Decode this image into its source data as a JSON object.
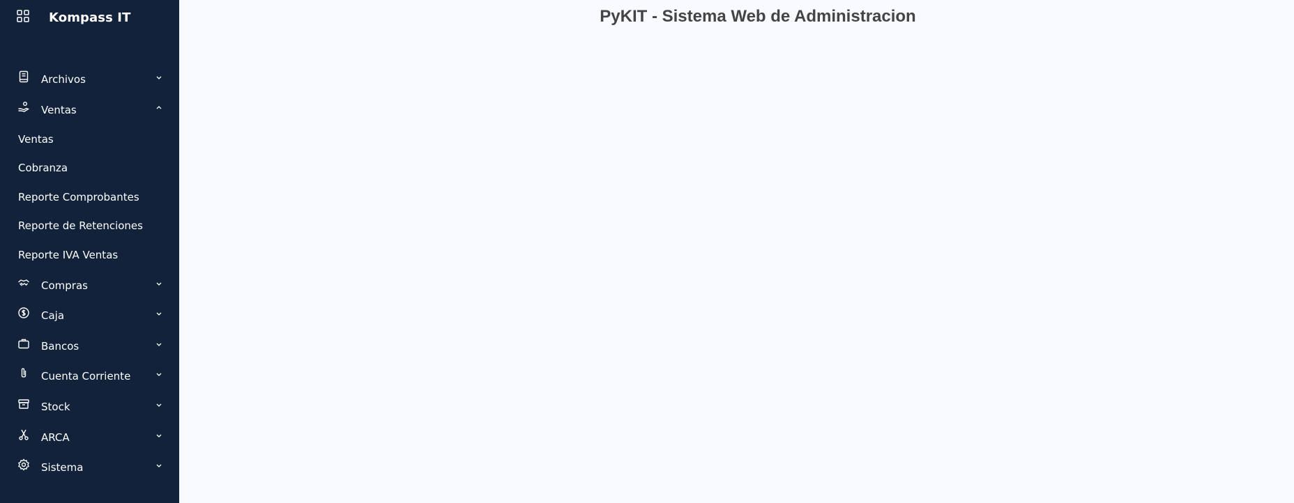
{
  "brand": {
    "title": "Kompass IT",
    "icon": "grid-icon"
  },
  "header": {
    "title": "PyKIT - Sistema Web de Administracion"
  },
  "sidebar": {
    "items": [
      {
        "label": "Archivos",
        "icon": "book-icon",
        "expanded": false
      },
      {
        "label": "Ventas",
        "icon": "hand-coin-icon",
        "expanded": true
      },
      {
        "label": "Compras",
        "icon": "handshake-icon",
        "expanded": false
      },
      {
        "label": "Caja",
        "icon": "dollar-circle-icon",
        "expanded": false
      },
      {
        "label": "Bancos",
        "icon": "briefcase-icon",
        "expanded": false
      },
      {
        "label": "Cuenta Corriente",
        "icon": "paperclip-icon",
        "expanded": false
      },
      {
        "label": "Stock",
        "icon": "archive-icon",
        "expanded": false
      },
      {
        "label": "ARCA",
        "icon": "scissors-icon",
        "expanded": false
      },
      {
        "label": "Sistema",
        "icon": "gear-icon",
        "expanded": false
      }
    ],
    "ventas_subitems": [
      {
        "label": "Ventas"
      },
      {
        "label": "Cobranza"
      },
      {
        "label": "Reporte Comprobantes"
      },
      {
        "label": "Reporte de Retenciones"
      },
      {
        "label": "Reporte IVA Ventas"
      }
    ]
  },
  "colors": {
    "sidebar_bg": "#11223a",
    "main_bg": "#f8faff",
    "title_text": "#444444",
    "sidebar_text": "#ffffff"
  }
}
